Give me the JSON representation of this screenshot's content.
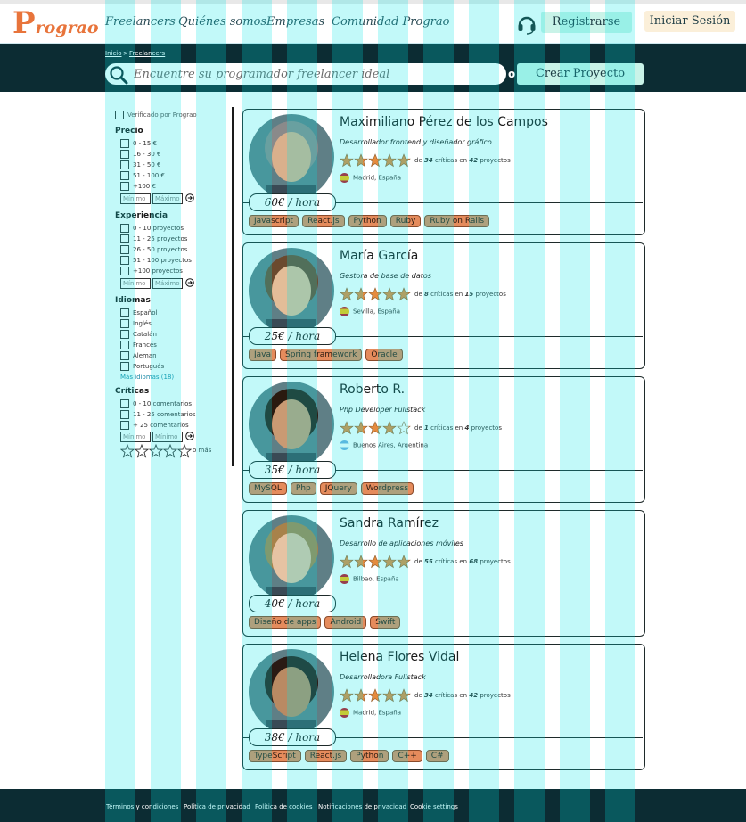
{
  "brand": {
    "logo_big": "P",
    "logo_rest": "rograo",
    "accent": "#e8743b",
    "dark_bg": "#0c2c33",
    "mint": "#c9f3e8"
  },
  "nav": {
    "items": [
      "Freelancers",
      "Quiénes somos",
      "Empresas",
      "Comunidad Prograo"
    ]
  },
  "header": {
    "register": "Registrarse",
    "login": "Iniciar Sesión",
    "support_icon": "headset-icon"
  },
  "breadcrumb": {
    "home": "Inicio",
    "sep": ">",
    "current": "Freelancers"
  },
  "search": {
    "placeholder": "Encuentre su programador freelancer ideal",
    "or": "o",
    "create_project": "Crear Proyecto",
    "icon": "search-icon"
  },
  "filters": {
    "verified": "Verificado por Prograo",
    "price": {
      "title": "Precio",
      "options": [
        "0 - 15 €",
        "16 - 30 €",
        "31 - 50 €",
        "51 - 100 €",
        "+100 €"
      ],
      "min": "Mínimo",
      "max": "Máximo"
    },
    "experience": {
      "title": "Experiencia",
      "options": [
        "0 - 10 proyectos",
        "11 - 25 proyectos",
        "26 - 50 proyectos",
        "51 - 100 proyectos",
        "+100 proyectos"
      ],
      "min": "Mínimo",
      "max": "Máximo"
    },
    "languages": {
      "title": "Idiomas",
      "options": [
        "Español",
        "Inglés",
        "Catalán",
        "Francés",
        "Aleman",
        "Portugués"
      ],
      "more": "Más idiomas (18)"
    },
    "reviews": {
      "title": "Críticas",
      "options": [
        "0 - 10 comentarios",
        "11 - 25 comentarios",
        "+ 25 comentarios"
      ],
      "min": "Mínimo",
      "max": "Mínimo",
      "stars_suffix": "o más"
    }
  },
  "freelancers": [
    {
      "name": "Maximiliano Pérez de los Campos",
      "role": "Desarrollador frontend y diseñador gráfico",
      "stars": 5,
      "reviews": "34",
      "projects": "42",
      "location": "Madrid, España",
      "country": "es",
      "price": "60€ / hora",
      "tags": [
        "Javascript",
        "React.js",
        "Python",
        "Ruby",
        "Ruby on Rails"
      ]
    },
    {
      "name": "María García",
      "role": "Gestora de base de datos",
      "stars": 5,
      "reviews": "8",
      "projects": "15",
      "location": "Sevilla, España",
      "country": "es",
      "price": "25€ / hora",
      "tags": [
        "Java",
        "Spring framework",
        "Oracle"
      ]
    },
    {
      "name": "Roberto R.",
      "role": "Php Developer Fullstack",
      "stars": 4,
      "reviews": "1",
      "projects": "4",
      "location": "Buenos Aires, Argentina",
      "country": "ar",
      "price": "35€ / hora",
      "tags": [
        "MySQL",
        "Php",
        "JQuery",
        "Wordpress"
      ]
    },
    {
      "name": "Sandra Ramírez",
      "role": "Desarrollo de aplicaciones móviles",
      "stars": 5,
      "reviews": "55",
      "projects": "68",
      "location": "Bilbao, España",
      "country": "es",
      "price": "40€ / hora",
      "tags": [
        "Diseño de apps",
        "Android",
        "Swift"
      ]
    },
    {
      "name": "Helena Flores Vidal",
      "role": "Desarrolladora Fullstack",
      "stars": 5,
      "reviews": "34",
      "projects": "42",
      "location": "Madrid, España",
      "country": "es",
      "price": "38€ / hora",
      "tags": [
        "TypeScript",
        "React.js",
        "Python",
        "C++",
        "C#"
      ]
    }
  ],
  "rating_words": {
    "of": "de",
    "reviews_in": "críticas en",
    "projects": "proyectos"
  },
  "footer": {
    "links": [
      "Términos y condiciones",
      "Política de privacidad",
      "Política de cookies",
      "Notificaciones de privacidad",
      "Cookie settings"
    ]
  }
}
